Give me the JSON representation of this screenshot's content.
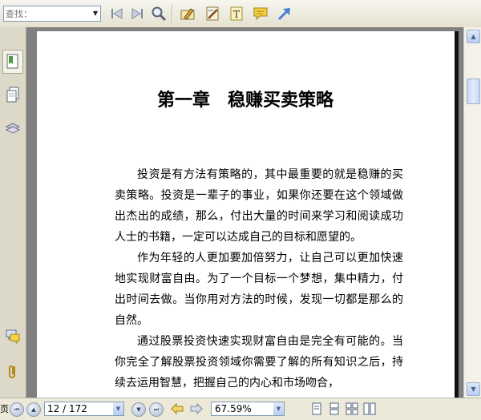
{
  "toolbar": {
    "search_placeholder": "查找：",
    "icons": [
      "previous-result-icon",
      "next-result-icon",
      "search-window-icon",
      "highlight-tool-icon",
      "pencil-markup-icon",
      "text-box-icon",
      "comment-note-icon",
      "arrow-tool-icon"
    ]
  },
  "sidebar": {
    "panels": [
      "bookmarks-panel",
      "pages-panel",
      "layers-panel",
      "comments-panel",
      "attachments-panel"
    ]
  },
  "document": {
    "chapter_title": "第一章　稳赚买卖策略",
    "paragraphs": [
      "投资是有方法有策略的，其中最重要的就是稳赚的买卖策略。投资是一辈子的事业，如果你还要在这个领域做出杰出的成绩，那么，付出大量的时间来学习和阅读成功人士的书籍，一定可以达成自己的目标和愿望的。",
      "作为年轻的人更加要加倍努力，让自己可以更加快速地实现财富自由。为了一个目标一个梦想，集中精力，付出时间去做。当你用对方法的时候，发现一切都是那么的自然。",
      "通过股票投资快速实现财富自由是完全有可能的。当你完全了解股票投资领域你需要了解的所有知识之后，持续去运用智慧，把握自己的内心和市场吻合，"
    ]
  },
  "status": {
    "left_clip": "页",
    "page_indicator": "12 / 172",
    "zoom": "67.59%"
  },
  "colors": {
    "accent": "#316ac5",
    "toolbar_bg": "#ece9d8",
    "viewer_bg": "#808080"
  }
}
